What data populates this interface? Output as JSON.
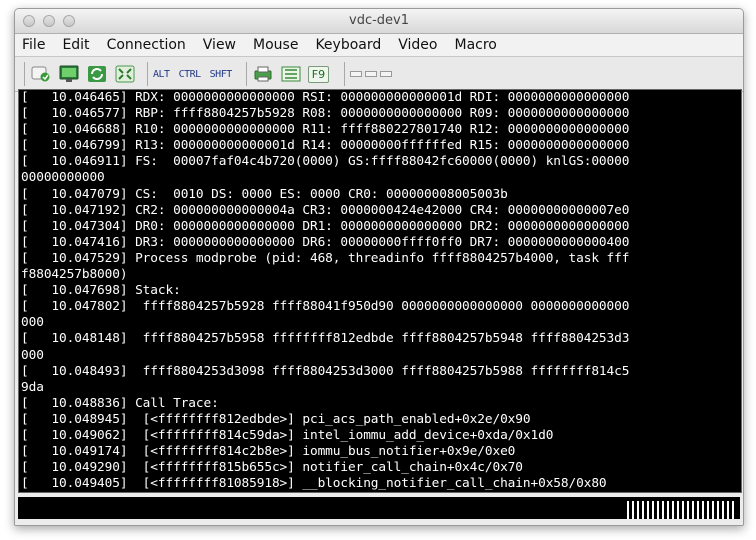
{
  "window": {
    "title": "vdc-dev1"
  },
  "menu": [
    "File",
    "Edit",
    "Connection",
    "View",
    "Mouse",
    "Keyboard",
    "Video",
    "Macro"
  ],
  "toolbar": {
    "alt_label": "ALT",
    "ctrl_label": "CTRL",
    "shift_label": "SHFT",
    "f9_label": "F9",
    "icons": [
      "refresh-screen-icon",
      "monitor-icon",
      "sync-icon",
      "fit-screen-icon",
      "print-screen-icon",
      "capture-icon"
    ]
  },
  "console": {
    "lines": [
      "[   10.046465] RDX: 0000000000000000 RSI: 000000000000001d RDI: 0000000000000000",
      "[   10.046577] RBP: ffff8804257b5928 R08: 0000000000000000 R09: 0000000000000000",
      "[   10.046688] R10: 0000000000000000 R11: ffff880227801740 R12: 0000000000000000",
      "[   10.046799] R13: 000000000000001d R14: 00000000ffffffed R15: 0000000000000000",
      "[   10.046911] FS:  00007faf04c4b720(0000) GS:ffff88042fc60000(0000) knlGS:00000",
      "00000000000",
      "[   10.047079] CS:  0010 DS: 0000 ES: 0000 CR0: 000000008005003b",
      "[   10.047192] CR2: 000000000000004a CR3: 0000000424e42000 CR4: 00000000000007e0",
      "[   10.047304] DR0: 0000000000000000 DR1: 0000000000000000 DR2: 0000000000000000",
      "[   10.047416] DR3: 0000000000000000 DR6: 00000000ffff0ff0 DR7: 0000000000000400",
      "[   10.047529] Process modprobe (pid: 468, threadinfo ffff8804257b4000, task fff",
      "f8804257b8000)",
      "[   10.047698] Stack:",
      "[   10.047802]  ffff8804257b5928 ffff88041f950d90 0000000000000000 0000000000000",
      "000",
      "[   10.048148]  ffff8804257b5958 ffffffff812edbde ffff8804257b5948 ffff8804253d3",
      "000",
      "[   10.048493]  ffff8804253d3098 ffff8804253d3000 ffff8804257b5988 ffffffff814c5",
      "9da",
      "[   10.048836] Call Trace:",
      "[   10.048945]  [<ffffffff812edbde>] pci_acs_path_enabled+0x2e/0x90",
      "[   10.049062]  [<ffffffff814c59da>] intel_iommu_add_device+0xda/0x1d0",
      "[   10.049174]  [<ffffffff814c2b8e>] iommu_bus_notifier+0x9e/0xe0",
      "[   10.049290]  [<ffffffff815b655c>] notifier_call_chain+0x4c/0x70",
      "[   10.049405]  [<ffffffff81085918>] __blocking_notifier_call_chain+0x58/0x80"
    ]
  }
}
